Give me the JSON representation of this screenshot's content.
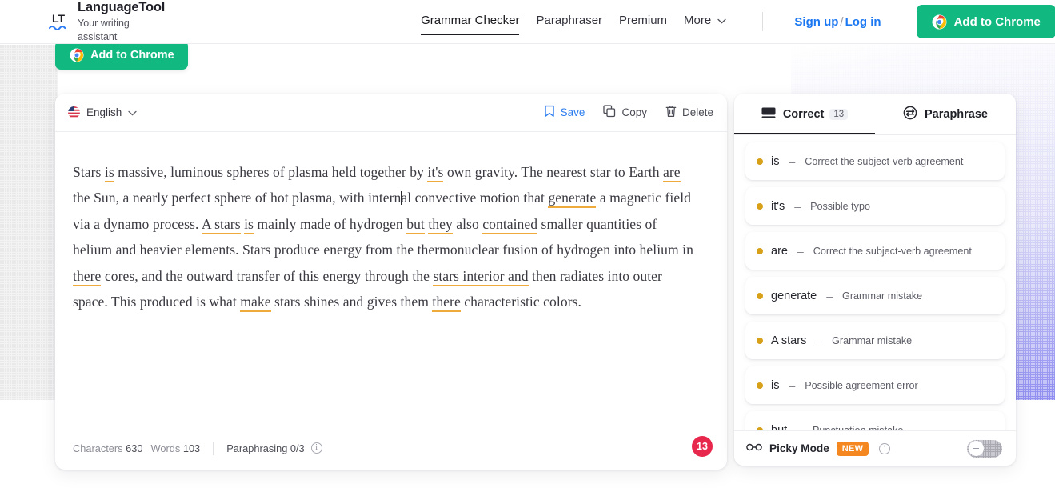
{
  "header": {
    "brand": {
      "name": "LanguageTool",
      "tagline": "Your writing assistant",
      "logo_icon": "lt-logo-icon"
    },
    "nav": [
      {
        "label": "Grammar Checker",
        "active": true
      },
      {
        "label": "Paraphraser",
        "active": false
      },
      {
        "label": "Premium",
        "active": false
      },
      {
        "label": "More",
        "active": false,
        "caret": "⌄"
      }
    ],
    "auth": {
      "signup": "Sign up",
      "separator": "/",
      "login": "Log in"
    },
    "cta": {
      "label": "Add to Chrome",
      "icon": "chrome-icon",
      "color": "#11b981"
    }
  },
  "floating_cta": {
    "label": "Add to Chrome",
    "icon": "chrome-icon"
  },
  "editor": {
    "language": {
      "label": "English",
      "flag_icon": "us-flag-icon",
      "caret_icon": "chevron-down-icon"
    },
    "actions": [
      {
        "label": "Save",
        "icon": "bookmark-icon",
        "color": "#2c7cf0"
      },
      {
        "label": "Copy",
        "icon": "copy-icon",
        "color": "#4a4b55"
      },
      {
        "label": "Delete",
        "icon": "trash-icon",
        "color": "#4a4b55"
      }
    ],
    "document": {
      "segments": [
        {
          "t": "Stars ",
          "e": false
        },
        {
          "t": "is",
          "e": true
        },
        {
          "t": " massive, luminous spheres of plasma held together by ",
          "e": false
        },
        {
          "t": "it's",
          "e": true
        },
        {
          "t": " own gravity. The nearest star to Earth ",
          "e": false
        },
        {
          "t": "are",
          "e": true
        },
        {
          "t": " the Sun, a nearly perfect sphere of hot plasma, with intern",
          "e": false
        },
        {
          "t": "|CARET|",
          "e": false
        },
        {
          "t": "al convective motion that ",
          "e": false
        },
        {
          "t": "generate",
          "e": true
        },
        {
          "t": " a magnetic field via a dynamo process. ",
          "e": false
        },
        {
          "t": "A stars",
          "e": true
        },
        {
          "t": " ",
          "e": false
        },
        {
          "t": "is",
          "e": true
        },
        {
          "t": " mainly made of hydrogen ",
          "e": false
        },
        {
          "t": "but",
          "e": true
        },
        {
          "t": " ",
          "e": false
        },
        {
          "t": "they",
          "e": true
        },
        {
          "t": " also ",
          "e": false
        },
        {
          "t": "contained",
          "e": true
        },
        {
          "t": " smaller quantities of helium and heavier elements. Stars produce energy from the thermonuclear fusion of hydrogen into helium in ",
          "e": false
        },
        {
          "t": "there",
          "e": true
        },
        {
          "t": " cores, and the outward transfer of this energy through the ",
          "e": false
        },
        {
          "t": "stars interior and",
          "e": true
        },
        {
          "t": " then radiates into outer space. This produced is what ",
          "e": false
        },
        {
          "t": "make",
          "e": true
        },
        {
          "t": " stars shines and gives them ",
          "e": false
        },
        {
          "t": "there",
          "e": true
        },
        {
          "t": " characteristic colors.",
          "e": false
        }
      ]
    },
    "footer": {
      "characters_label": "Characters",
      "characters_value": "630",
      "words_label": "Words",
      "words_value": "103",
      "paraphrasing_label": "Paraphrasing 0/3",
      "info_icon": "info-icon",
      "error_count": "13"
    }
  },
  "panel": {
    "tabs": [
      {
        "label": "Correct",
        "badge": "13",
        "icon": "keyboard-icon",
        "active": true
      },
      {
        "label": "Paraphrase",
        "badge": "",
        "icon": "refresh-circle-icon",
        "active": false
      }
    ],
    "suggestions": [
      {
        "word": "is",
        "dash": "–",
        "desc": "Correct the subject-verb agreement"
      },
      {
        "word": "it's",
        "dash": "–",
        "desc": "Possible typo"
      },
      {
        "word": "are",
        "dash": "–",
        "desc": "Correct the subject-verb agreement"
      },
      {
        "word": "generate",
        "dash": "–",
        "desc": "Grammar mistake"
      },
      {
        "word": "A stars",
        "dash": "–",
        "desc": "Grammar mistake"
      },
      {
        "word": "is",
        "dash": "–",
        "desc": "Possible agreement error"
      },
      {
        "word": "but",
        "dash": "–",
        "desc": "Punctuation mistake"
      }
    ],
    "picky_mode": {
      "label": "Picky Mode",
      "badge": "NEW",
      "glasses_icon": "glasses-icon",
      "info_icon": "info-icon",
      "toggle_state": "off"
    }
  }
}
